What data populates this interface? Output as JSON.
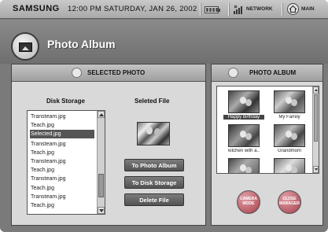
{
  "topbar": {
    "brand": "SAMSUNG",
    "datetime": "12:00 PM SATURDAY, JAN 26, 2002",
    "network_label": "NETWORK",
    "main_label": "MAIN"
  },
  "header": {
    "title": "Photo Album",
    "icon": "photo-album-icon"
  },
  "selected_panel": {
    "title": "SELECTED PHOTO",
    "disk_storage_label": "Disk Storage",
    "selected_file_label": "Seleted File",
    "files": [
      "Transteam.jpg",
      "Teach.jpg",
      "Selected.jpg",
      "Transteam.jpg",
      "Teach.jpg",
      "Transteam.jpg",
      "Teach.jpg",
      "Transteam.jpg",
      "Teach.jpg",
      "Transteam.jpg",
      "Teach.jpg"
    ],
    "selected_file": "Selected.jpg",
    "buttons": {
      "to_album": "To Photo Album",
      "to_disk": "To Disk Storage",
      "delete": "Delete File"
    }
  },
  "album_panel": {
    "title": "PHOTO ALBUM",
    "photos": [
      "Happy birthday",
      "My Family",
      "kitchen with a..",
      "Grandmom",
      "",
      ""
    ],
    "selected_photo": "Happy birthday",
    "buttons": {
      "camera_mode": "CAMERA MODE",
      "close_manager": "CLOSE MANAGER"
    }
  },
  "colors": {
    "frame": "#7a7a7a",
    "panel": "#d9d9d9",
    "button": "#5a5a5a",
    "round_button": "#b85c66"
  }
}
